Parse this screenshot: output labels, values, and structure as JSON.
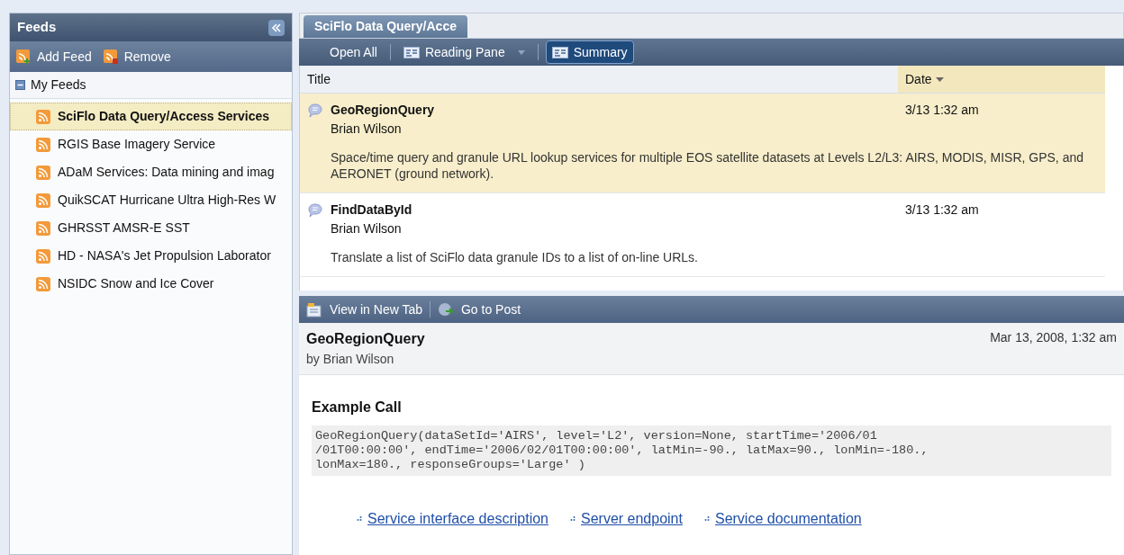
{
  "sidebar": {
    "title": "Feeds",
    "toolbar": [
      "Add Feed",
      "Remove"
    ],
    "group": {
      "label": "My Feeds",
      "expanded": true,
      "items": [
        {
          "label": "SciFlo Data Query/Access Services",
          "selected": true
        },
        {
          "label": "RGIS Base Imagery Service",
          "selected": false
        },
        {
          "label": "ADaM Services: Data mining and imag",
          "selected": false
        },
        {
          "label": "QuikSCAT Hurricane Ultra High-Res W",
          "selected": false
        },
        {
          "label": "GHRSST AMSR-E SST",
          "selected": false
        },
        {
          "label": "HD - NASA's Jet Propulsion Laborator",
          "selected": false
        },
        {
          "label": "NSIDC Snow and Ice Cover",
          "selected": false
        }
      ]
    }
  },
  "tabs": [
    {
      "label": "SciFlo Data Query/Acce",
      "selected": true
    }
  ],
  "toolbar": [
    {
      "label": "Open All",
      "kind": "plain",
      "selected": false
    },
    {
      "label": "Reading Pane",
      "kind": "dropdown",
      "selected": false
    },
    {
      "label": "Summary",
      "kind": "toggle",
      "selected": true
    }
  ],
  "list": {
    "columns": [
      "Title",
      "Date"
    ],
    "rows": [
      {
        "title": "GeoRegionQuery",
        "author": "Brian Wilson",
        "date": "3/13 1:32 am",
        "summary": "Space/time query and granule URL lookup services for multiple EOS satellite datasets at Levels L2/L3: AIRS, MODIS, MISR, GPS, and AERONET (ground network).",
        "selected": true
      },
      {
        "title": "FindDataById",
        "author": "Brian Wilson",
        "date": "3/13 1:32 am",
        "summary": "Translate a list of SciFlo data granule IDs to a list of on-line URLs.",
        "selected": false
      }
    ]
  },
  "reading_toolbar": [
    "View in New Tab",
    "Go to Post"
  ],
  "post": {
    "title": "GeoRegionQuery",
    "byline": "by Brian Wilson",
    "date": "Mar 13, 2008, 1:32 am",
    "heading": "Example Call",
    "code_lines": [
      "GeoRegionQuery(dataSetId='AIRS', level='L2', version=None, startTime='2006/01",
      "/01T00:00:00', endTime='2006/02/01T00:00:00', latMin=-90., latMax=90., lonMin=-180.,",
      "lonMax=180., responseGroups='Large' )"
    ],
    "links": [
      "Service interface description",
      "Server endpoint",
      "Service documentation"
    ]
  }
}
